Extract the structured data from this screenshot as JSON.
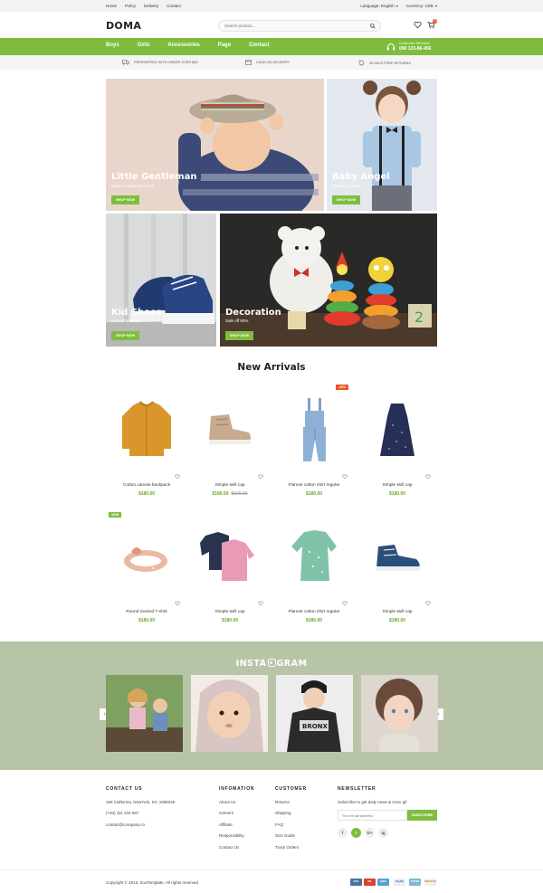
{
  "topbar": {
    "links": [
      "Home",
      "Policy",
      "Delivery",
      "Contact"
    ],
    "language": "Language: English",
    "currency": "Currency: USD"
  },
  "header": {
    "logo": "DOMA",
    "search_placeholder": "Search product...",
    "cart_count": "0"
  },
  "nav": {
    "items": [
      "Boys",
      "Girls",
      "Accessories",
      "Page",
      "Contact"
    ],
    "customer_service_label": "Customer Services",
    "customer_service_phone": "090 123-86-456"
  },
  "services": [
    {
      "icon": "truck-icon",
      "label": "Freeshiping with order over $99"
    },
    {
      "icon": "wallet-icon",
      "label": "Cash on delivery"
    },
    {
      "icon": "return-icon",
      "label": "30 days free returns"
    }
  ],
  "banners": [
    {
      "title": "Little Gentleman",
      "subtitle": "Easy to make your look",
      "button": "SHOP NOW"
    },
    {
      "title": "Baby Angel",
      "subtitle": "Natural & Clean",
      "button": "SHOP NOW"
    },
    {
      "title": "Kid Shoes",
      "subtitle": "Natural & Clean",
      "button": "SHOP NOW"
    },
    {
      "title": "Decoration",
      "subtitle": "Sale off 50%",
      "button": "SHOP NOW"
    }
  ],
  "new_arrivals": {
    "title": "New Arrivals",
    "products": [
      {
        "name": "Cotton canvas backpack",
        "price": "$180.00",
        "old_price": "",
        "badge": "",
        "icon": "sweater-icon"
      },
      {
        "name": "Simple twill cap",
        "price": "$180.00",
        "old_price": "$199.00",
        "badge": "",
        "icon": "sneaker-icon"
      },
      {
        "name": "Flannel cotton shirt regular",
        "price": "$180.00",
        "old_price": "",
        "badge": "-40%",
        "icon": "overalls-icon"
      },
      {
        "name": "Simple twill cap",
        "price": "$180.00",
        "old_price": "",
        "badge": "",
        "icon": "dress-icon"
      },
      {
        "name": "Round necked T-shirt",
        "price": "$180.00",
        "old_price": "",
        "badge": "NEW",
        "icon": "headband-icon"
      },
      {
        "name": "Simple twill cap",
        "price": "$180.00",
        "old_price": "",
        "badge": "",
        "icon": "shirts-icon"
      },
      {
        "name": "Flannel cotton shirt regular",
        "price": "$180.00",
        "old_price": "",
        "badge": "",
        "icon": "blouse-icon"
      },
      {
        "name": "Simple twill cap",
        "price": "$180.00",
        "old_price": "",
        "badge": "",
        "icon": "shoe-icon"
      }
    ]
  },
  "instagram": {
    "title_left": "INSTA",
    "title_right": "GRAM",
    "prev": "‹",
    "next": "›"
  },
  "footer": {
    "contact": {
      "heading": "CONTACT US",
      "address": "169 California, NewYork, NY, 1008345",
      "phone": "(+84) 111 234 567",
      "email": "contact@company.co"
    },
    "information": {
      "heading": "INFOMATION",
      "links": [
        "About Us",
        "Careers",
        "Affiliate",
        "Responsibility",
        "Contact Us"
      ]
    },
    "customer": {
      "heading": "CUSTOMER",
      "links": [
        "Returns",
        "Shipping",
        "FAQ",
        "Size Guide",
        "Track Orders"
      ]
    },
    "newsletter": {
      "heading": "NEWSLETTER",
      "text": "Subscribe to get daily news & more gif",
      "placeholder": "Your email address",
      "button": "SUBSCRIBE",
      "social": [
        "f",
        "t",
        "G+",
        "ig"
      ]
    },
    "copyright": "Copyright © 2016. ZooTemplate. All rights reserved.",
    "payments": [
      "VISA",
      "MC",
      "AMEX",
      "PayPal",
      "STRIPE",
      "DISCOVER"
    ]
  },
  "colors": {
    "accent": "#80bd3f",
    "badge_sale": "#e85a28",
    "badge_new": "#80bd3f",
    "instagram_bg": "#b8c4a7"
  }
}
